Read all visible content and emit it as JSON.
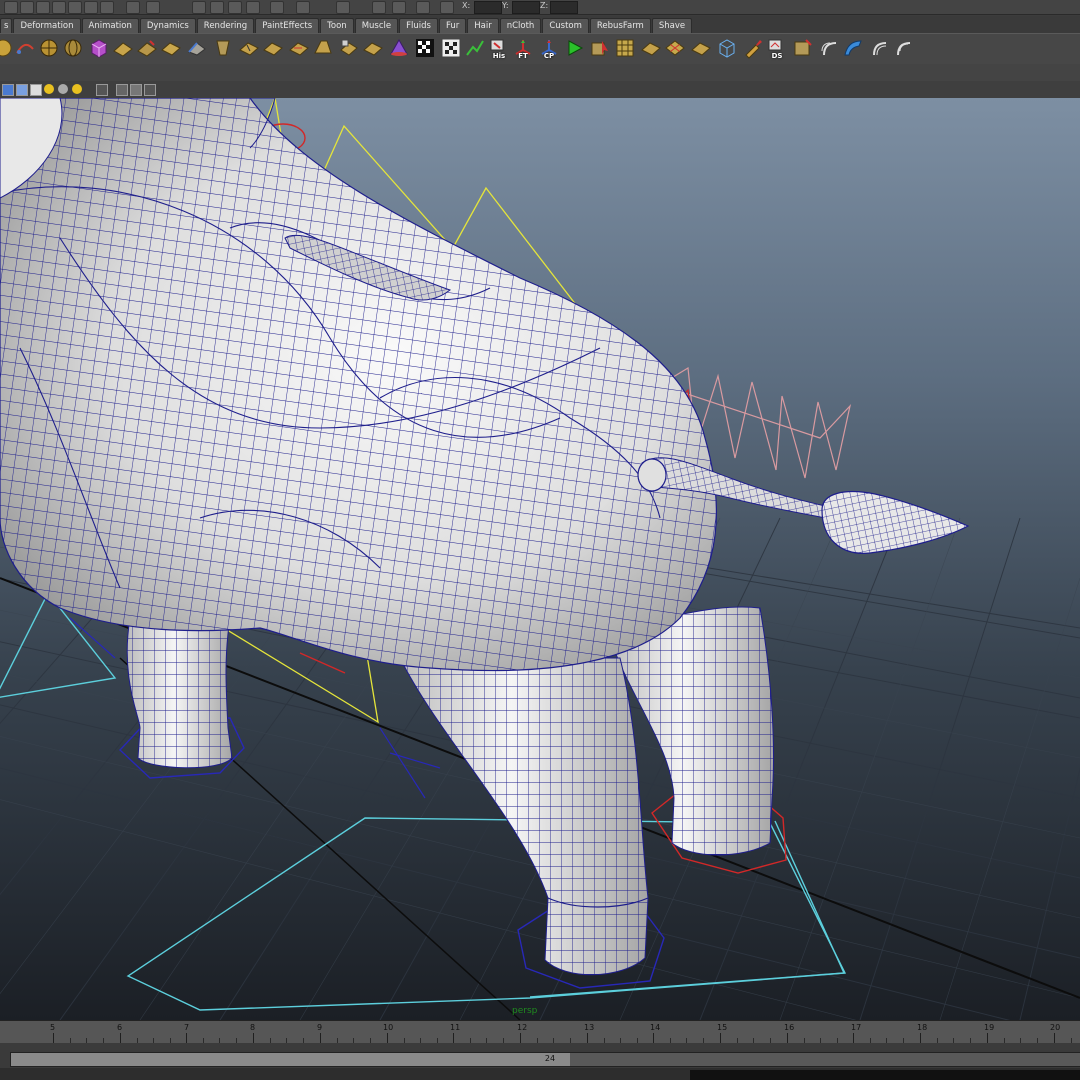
{
  "top_strip": {
    "coord_labels": [
      "X:",
      "Y:",
      "Z:"
    ]
  },
  "shelf": {
    "tabs": [
      "s",
      "Deformation",
      "Animation",
      "Dynamics",
      "Rendering",
      "PaintEffects",
      "Toon",
      "Muscle",
      "Fluids",
      "Fur",
      "Hair",
      "nCloth",
      "Custom",
      "RebusFarm",
      "Shave"
    ],
    "tool_labels": {
      "his": "His",
      "ft": "FT",
      "cp": "CP",
      "ds": "DS"
    }
  },
  "viewport": {
    "camera_label": "persp"
  },
  "time_slider": {
    "tick_labels": [
      "5",
      "6",
      "7",
      "8",
      "9",
      "10",
      "11",
      "12",
      "13",
      "14",
      "15",
      "16",
      "17",
      "18",
      "19",
      "20"
    ]
  },
  "range_slider": {
    "end_value": "24"
  },
  "colors": {
    "mesh_wire": "#1e1e8c",
    "joint_yellow": "#e5e53a",
    "control_cyan": "#5ccfdc",
    "control_red": "#d22828",
    "tail_pink": "#d99aa0"
  }
}
